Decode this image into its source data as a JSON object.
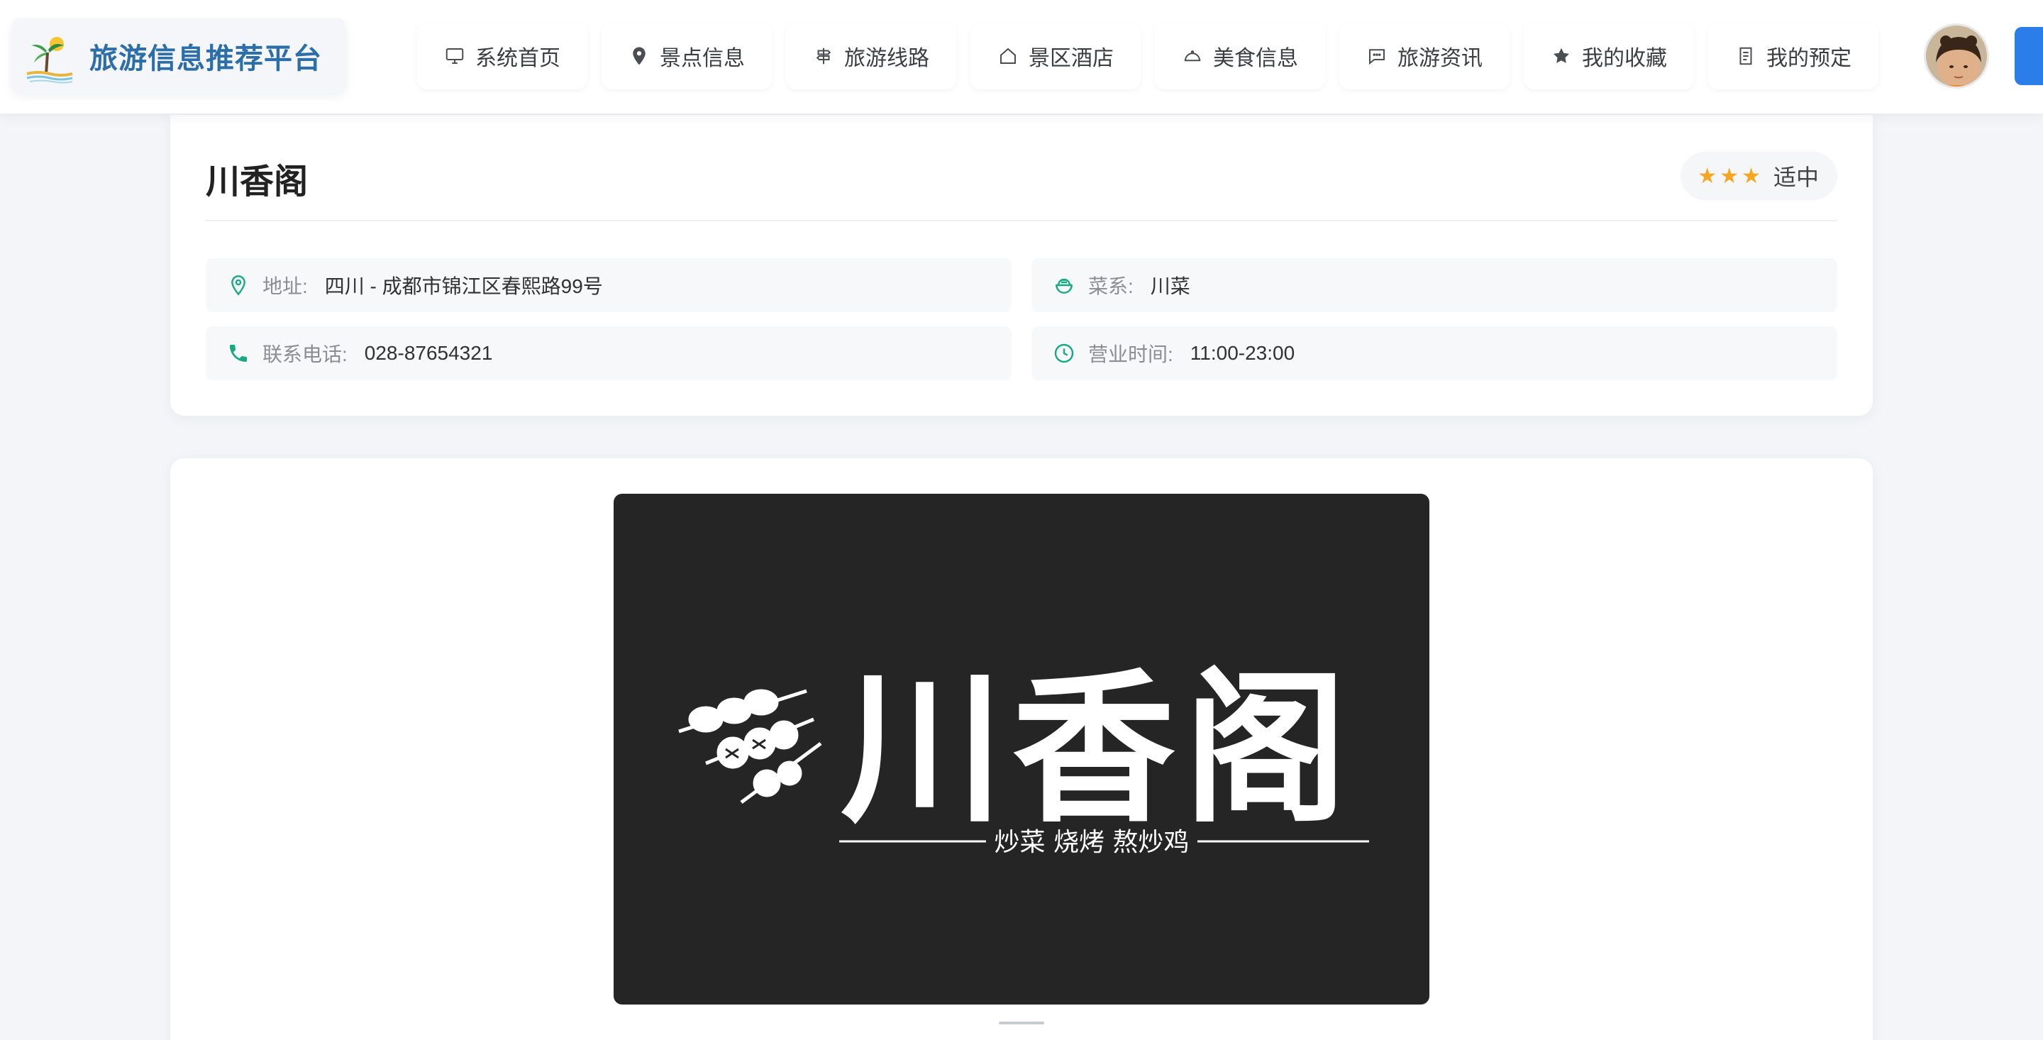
{
  "header": {
    "site_title": "旅游信息推荐平台",
    "nav": [
      {
        "label": "系统首页",
        "icon": "monitor-icon"
      },
      {
        "label": "景点信息",
        "icon": "location-pin-icon"
      },
      {
        "label": "旅游线路",
        "icon": "signpost-icon"
      },
      {
        "label": "景区酒店",
        "icon": "house-icon"
      },
      {
        "label": "美食信息",
        "icon": "food-cloche-icon"
      },
      {
        "label": "旅游资讯",
        "icon": "chat-bubble-icon"
      },
      {
        "label": "我的收藏",
        "icon": "star-icon"
      },
      {
        "label": "我的预定",
        "icon": "document-icon"
      }
    ]
  },
  "restaurant": {
    "name": "川香阁",
    "price_stars": "★★★",
    "price_level": "适中",
    "fields": {
      "address": {
        "label": "地址:",
        "value": "四川 - 成都市锦江区春熙路99号",
        "icon": "location-pin-icon"
      },
      "cuisine": {
        "label": "菜系:",
        "value": "川菜",
        "icon": "food-bowl-icon"
      },
      "phone": {
        "label": "联系电话:",
        "value": "028-87654321",
        "icon": "phone-icon"
      },
      "hours": {
        "label": "营业时间:",
        "value": "11:00-23:00",
        "icon": "clock-icon"
      }
    }
  },
  "banner": {
    "logo_text": "川香阁",
    "tagline": "炒菜 烧烤 熬炒鸡"
  },
  "colors": {
    "brand_title": "#2c6ea8",
    "accent_green": "#18a882",
    "star": "#f5a623",
    "banner_bg": "#252525",
    "primary_blue": "#2b7de9"
  }
}
